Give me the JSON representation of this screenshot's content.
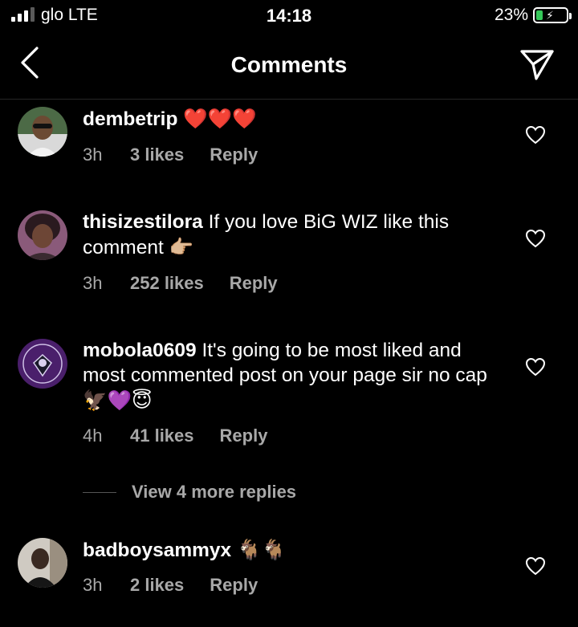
{
  "status_bar": {
    "carrier": "glo  LTE",
    "time": "14:18",
    "battery_percent": "23%",
    "battery_level": 0.23,
    "signal_bars_filled": 3,
    "signal_bars_total": 4
  },
  "header": {
    "title": "Comments",
    "back_icon": "chevron-left-icon",
    "share_icon": "paper-plane-icon"
  },
  "comments": [
    {
      "username": "dembetrip",
      "text": "",
      "emoji": "❤️❤️❤️",
      "time": "3h",
      "likes": "3 likes",
      "reply": "Reply"
    },
    {
      "username": "thisizestilora",
      "text": "If you love BiG WIZ like this comment",
      "emoji": "👉🏼",
      "time": "3h",
      "likes": "252 likes",
      "reply": "Reply"
    },
    {
      "username": "mobola0609",
      "text": "It's going to be most liked and most commented post on your page sir no cap",
      "emoji": "🦅💜😇",
      "time": "4h",
      "likes": "41 likes",
      "reply": "Reply"
    },
    {
      "username": "badboysammyx",
      "text": "",
      "emoji": "🐐🐐",
      "time": "3h",
      "likes": "2 likes",
      "reply": "Reply"
    }
  ],
  "view_replies": "View 4 more replies",
  "colors": {
    "background": "#000000",
    "secondary_text": "#a8a8a8",
    "battery_fill": "#35c759"
  }
}
